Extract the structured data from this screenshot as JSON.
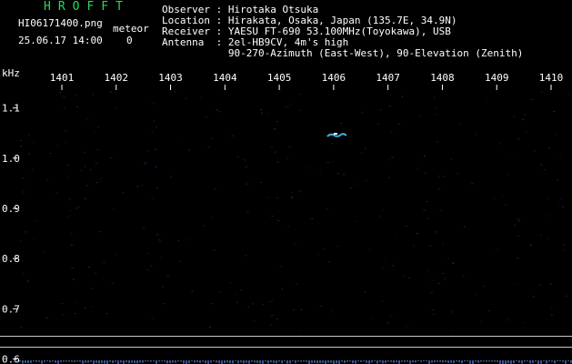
{
  "header": {
    "app_title": "HROFFT",
    "filename": "HI06171400.png",
    "timestamp": "25.06.17 14:00",
    "meteor_label": "meteor",
    "meteor_count": "0",
    "observer": "Observer : Hirotaka Otsuka",
    "location": "Location : Hirakata, Osaka, Japan (135.7E, 34.9N)",
    "receiver": "Receiver : YAESU FT-690 53.100MHz(Toyokawa), USB",
    "antenna": "Antenna  : 2el-HB9CV, 4m's high",
    "antenna2": "           90-270-Azimuth (East-West), 90-Elevation (Zenith)"
  },
  "chart_data": {
    "type": "heatmap",
    "ylabel": "kHz",
    "x_ticks": [
      "1401",
      "1402",
      "1403",
      "1404",
      "1405",
      "1406",
      "1407",
      "1408",
      "1409",
      "1410"
    ],
    "y_ticks": [
      "1.1",
      "1.0",
      "0.9",
      "0.8",
      "0.7",
      "0.6"
    ],
    "ylim": [
      0.59,
      1.17
    ],
    "colors": {
      "background": "#000000",
      "grid_dot": "#1a2a6a",
      "signal": "#3ab0e0",
      "baseline": "#c8c8c8",
      "text": "#ffffff",
      "title": "#22dd55"
    },
    "signals": [
      {
        "x": 1406.05,
        "y": 1.045,
        "label": ""
      }
    ]
  }
}
